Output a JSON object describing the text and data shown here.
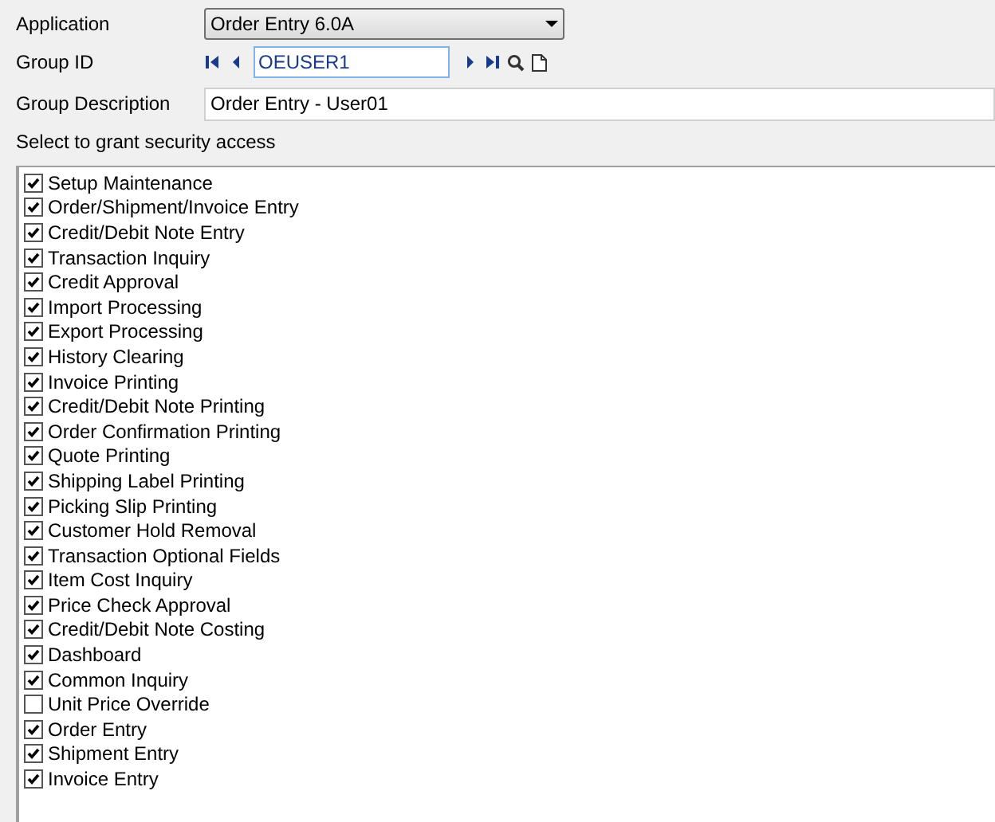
{
  "application": {
    "label": "Application",
    "value": "Order Entry 6.0A"
  },
  "group_id": {
    "label": "Group ID",
    "value": "OEUSER1"
  },
  "group_description": {
    "label": "Group Description",
    "value": "Order Entry - User01"
  },
  "access_list": {
    "label": "Select to grant security access",
    "items": [
      {
        "label": "Setup Maintenance",
        "checked": true
      },
      {
        "label": "Order/Shipment/Invoice Entry",
        "checked": true
      },
      {
        "label": "Credit/Debit Note Entry",
        "checked": true
      },
      {
        "label": "Transaction Inquiry",
        "checked": true
      },
      {
        "label": "Credit Approval",
        "checked": true
      },
      {
        "label": "Import Processing",
        "checked": true
      },
      {
        "label": "Export Processing",
        "checked": true
      },
      {
        "label": "History Clearing",
        "checked": true
      },
      {
        "label": "Invoice Printing",
        "checked": true
      },
      {
        "label": "Credit/Debit Note Printing",
        "checked": true
      },
      {
        "label": "Order Confirmation Printing",
        "checked": true
      },
      {
        "label": "Quote Printing",
        "checked": true
      },
      {
        "label": "Shipping Label Printing",
        "checked": true
      },
      {
        "label": "Picking Slip Printing",
        "checked": true
      },
      {
        "label": "Customer Hold Removal",
        "checked": true
      },
      {
        "label": "Transaction Optional Fields",
        "checked": true
      },
      {
        "label": "Item Cost Inquiry",
        "checked": true
      },
      {
        "label": "Price Check Approval",
        "checked": true
      },
      {
        "label": "Credit/Debit Note Costing",
        "checked": true
      },
      {
        "label": "Dashboard",
        "checked": true
      },
      {
        "label": "Common Inquiry",
        "checked": true
      },
      {
        "label": "Unit Price Override",
        "checked": false
      },
      {
        "label": "Order Entry",
        "checked": true
      },
      {
        "label": "Shipment Entry",
        "checked": true
      },
      {
        "label": "Invoice Entry",
        "checked": true
      }
    ]
  }
}
